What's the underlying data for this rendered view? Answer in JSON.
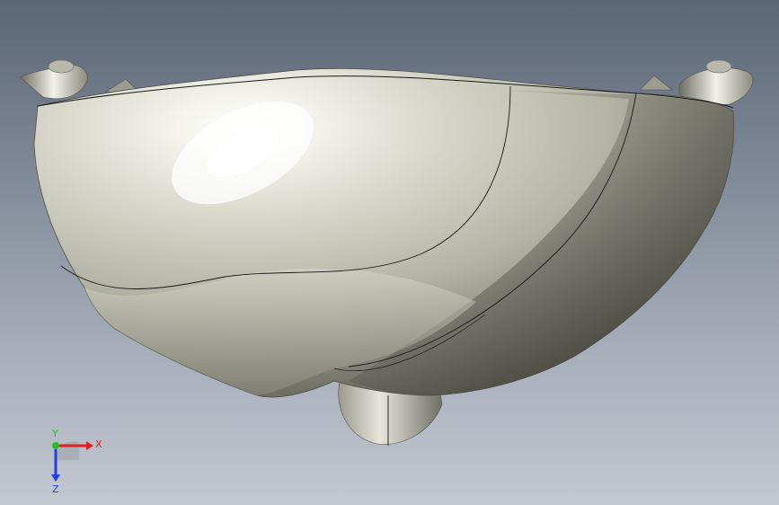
{
  "viewport": {
    "background_top": "#5b6676",
    "background_bottom": "#c3c8d1"
  },
  "model": {
    "name": "bowl-shell-body",
    "surface_color": "#c8c8bc",
    "highlight_color": "#ffffff",
    "shadow_color": "#3a3a34",
    "edge_color": "#1a1a1a"
  },
  "triad": {
    "x_label": "X",
    "y_label": "Y",
    "z_label": "Z",
    "x_color": "#e02020",
    "y_color": "#20c020",
    "z_color": "#2040e0"
  }
}
